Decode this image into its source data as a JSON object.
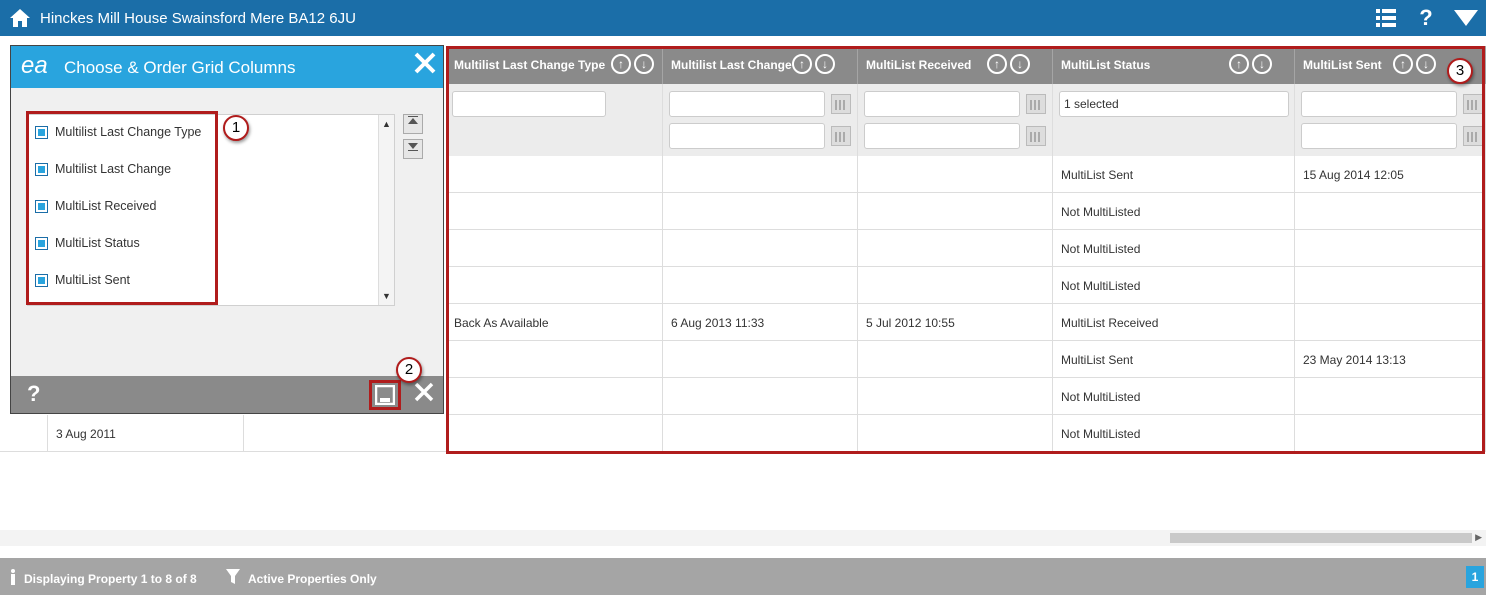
{
  "topbar": {
    "title": "Hinckes Mill House Swainsford Mere BA12 6JU",
    "help": "?"
  },
  "dialog": {
    "logo": "ea",
    "title": "Choose & Order Grid Columns",
    "items": [
      {
        "label": "Multilist Last Change Type"
      },
      {
        "label": "Multilist Last Change"
      },
      {
        "label": "MultiList Received"
      },
      {
        "label": "MultiList Status"
      },
      {
        "label": "MultiList Sent"
      }
    ],
    "help": "?"
  },
  "background_row": {
    "date": "3 Aug 2011"
  },
  "grid": {
    "columns": [
      {
        "label": "Multilist Last Change Type"
      },
      {
        "label": "Multilist Last Change"
      },
      {
        "label": "MultiList Received"
      },
      {
        "label": "MultiList Status"
      },
      {
        "label": "MultiList Sent"
      }
    ],
    "status_filter": "1 selected",
    "rows": [
      [
        "",
        "",
        "",
        "MultiList Sent",
        "15 Aug 2014 12:05"
      ],
      [
        "",
        "",
        "",
        "Not MultiListed",
        ""
      ],
      [
        "",
        "",
        "",
        "Not MultiListed",
        ""
      ],
      [
        "",
        "",
        "",
        "Not MultiListed",
        ""
      ],
      [
        "Back As Available",
        "6 Aug 2013 11:33",
        "5 Jul 2012 10:55",
        "MultiList Received",
        ""
      ],
      [
        "",
        "",
        "",
        "MultiList Sent",
        "23 May 2014 13:13"
      ],
      [
        "",
        "",
        "",
        "Not MultiListed",
        ""
      ],
      [
        "",
        "",
        "",
        "Not MultiListed",
        ""
      ]
    ]
  },
  "callouts": [
    "1",
    "2",
    "3"
  ],
  "status": {
    "display": "Displaying Property 1 to 8 of 8",
    "filter": "Active Properties Only",
    "page": "1"
  }
}
